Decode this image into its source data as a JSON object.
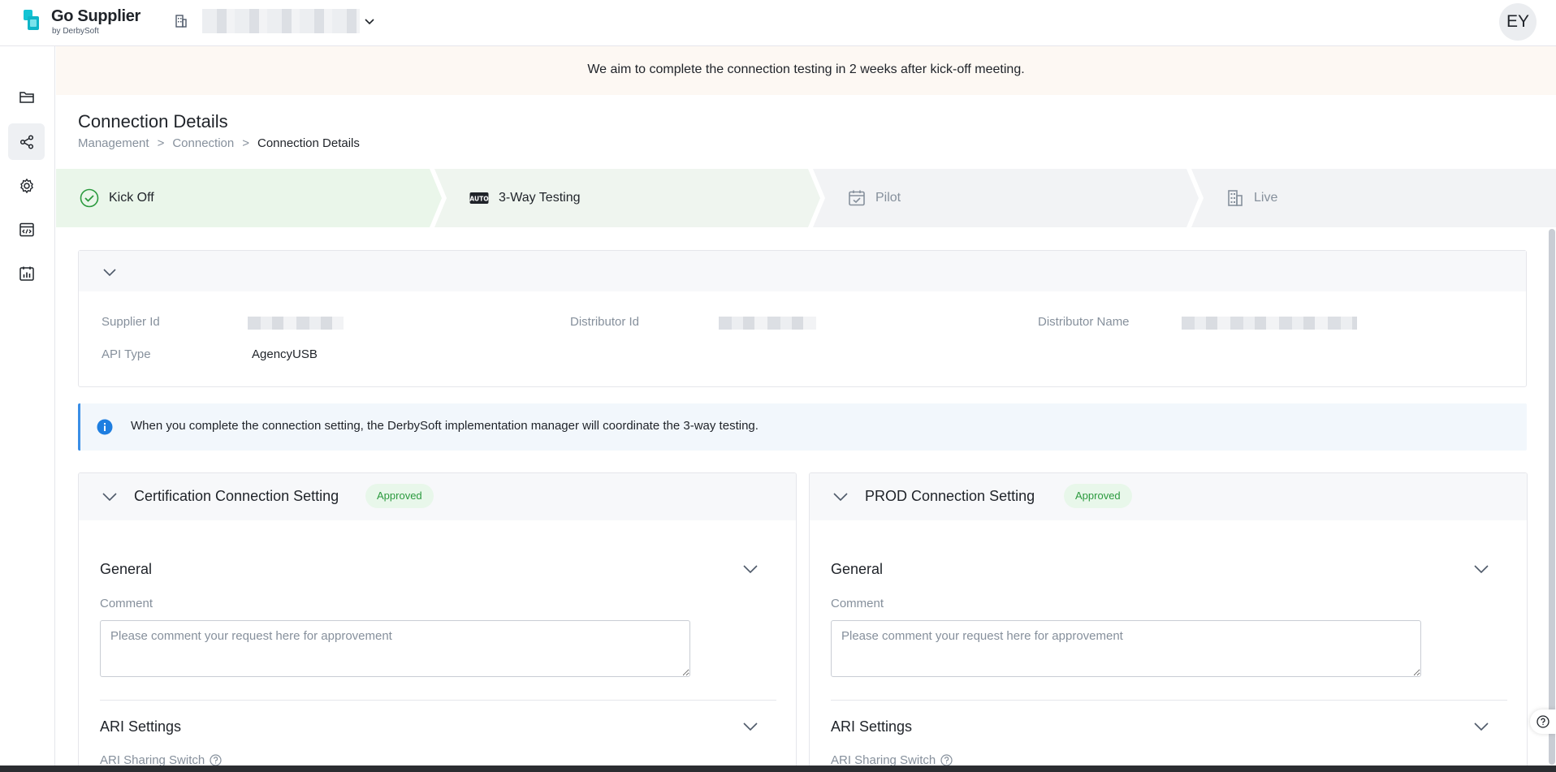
{
  "app": {
    "brand_name": "Go Supplier",
    "brand_sub": "by DerbySoft",
    "avatar_initials": "EY"
  },
  "notice": "We aim to complete the connection testing in 2 weeks after kick-off meeting.",
  "page": {
    "title": "Connection Details",
    "breadcrumb": [
      "Management",
      ">",
      "Connection",
      ">",
      "Connection Details"
    ]
  },
  "steps": [
    {
      "label": "Kick Off",
      "state": "done",
      "icon": "check-circle-icon"
    },
    {
      "label": "3-Way Testing",
      "state": "current",
      "icon": "auto-icon"
    },
    {
      "label": "Pilot",
      "state": "pending",
      "icon": "calendar-check-icon"
    },
    {
      "label": "Live",
      "state": "pending",
      "icon": "building-icon"
    }
  ],
  "summary": {
    "supplier_id_label": "Supplier Id",
    "distributor_id_label": "Distributor Id",
    "distributor_name_label": "Distributor Name",
    "api_type_label": "API Type",
    "api_type_value": "AgencyUSB"
  },
  "info_message": "When you complete the connection setting, the DerbySoft implementation manager will coordinate the 3-way testing.",
  "panels": [
    {
      "title": "Certification Connection Setting",
      "status": "Approved",
      "general_title": "General",
      "comment_label": "Comment",
      "comment_placeholder": "Please comment your request here for approvement",
      "ari_title": "ARI Settings",
      "ari_switch_label": "ARI Sharing Switch"
    },
    {
      "title": "PROD Connection Setting",
      "status": "Approved",
      "general_title": "General",
      "comment_label": "Comment",
      "comment_placeholder": "Please comment your request here for approvement",
      "ari_title": "ARI Settings",
      "ari_switch_label": "ARI Sharing Switch"
    }
  ],
  "colors": {
    "accent": "#3a8ee6",
    "success": "#2b9a3e",
    "step_done_bg": "#eaf6ea",
    "step_pending_bg": "#f2f3f5",
    "notice_bg": "#fdf8f3",
    "logo_primary": "#14c4d4"
  }
}
